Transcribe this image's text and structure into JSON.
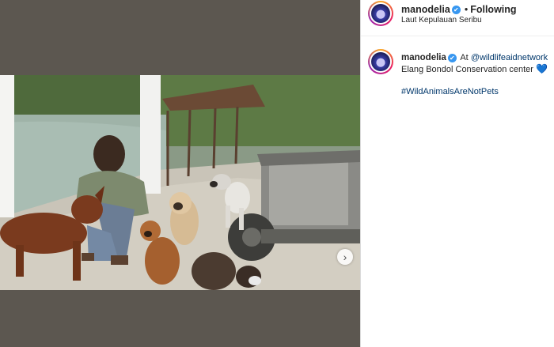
{
  "post": {
    "username": "manodelia",
    "follow_status": "Following",
    "separator": "•",
    "location": "Laut Kepulauan Seribu",
    "verified_icon": "✔",
    "next_icon": "›"
  },
  "caption": {
    "username": "manodelia",
    "at_text": "At",
    "mention": "@wildlifeaidnetwork",
    "body": "Elang Bondol Conservation center",
    "heart": "💙",
    "hashtag": "#WildAnimalsAreNotPets"
  },
  "colors": {
    "verified_blue": "#3897f0",
    "link_blue": "#00376b",
    "media_background": "#5c5750"
  }
}
